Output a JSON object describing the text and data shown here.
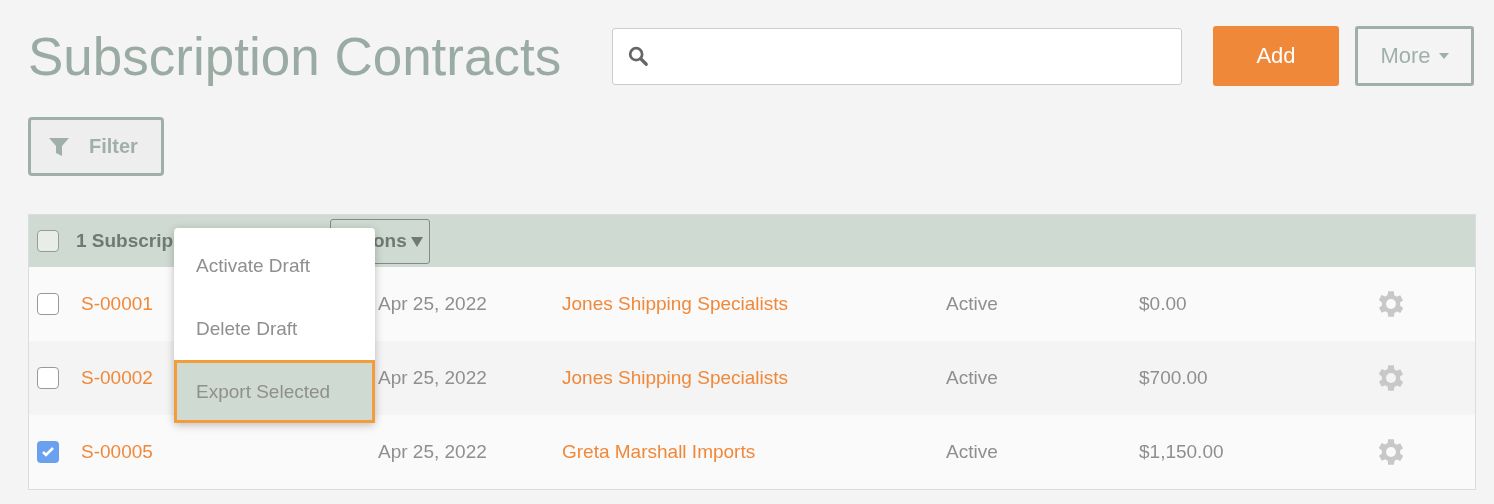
{
  "header": {
    "title": "Subscription Contracts",
    "buttons": [
      {
        "kind": "primary",
        "label": "Add"
      },
      {
        "kind": "dropdown",
        "label": "More"
      }
    ]
  },
  "filter": {
    "label": "Filter"
  },
  "table": {
    "select_all": {
      "checked": false
    },
    "selection_label": "1 Subscrip",
    "actions_button": {
      "label": "ons"
    },
    "rows": [
      {
        "checked": false,
        "id": "S-00001",
        "date": "Apr 25, 2022",
        "customer": "Jones Shipping Specialists",
        "status": "Active",
        "amount": "$0.00"
      },
      {
        "checked": false,
        "id": "S-00002",
        "date": "Apr 25, 2022",
        "customer": "Jones Shipping Specialists",
        "status": "Active",
        "amount": "$700.00"
      },
      {
        "checked": true,
        "id": "S-00005",
        "date": "Apr 25, 2022",
        "customer": "Greta Marshall Imports",
        "status": "Active",
        "amount": "$1,150.00"
      }
    ]
  },
  "actions_menu": {
    "items": [
      {
        "label": "Activate Draft",
        "selected": false
      },
      {
        "label": "Delete Draft",
        "selected": false
      },
      {
        "label": "Export Selected",
        "selected": true
      }
    ]
  }
}
